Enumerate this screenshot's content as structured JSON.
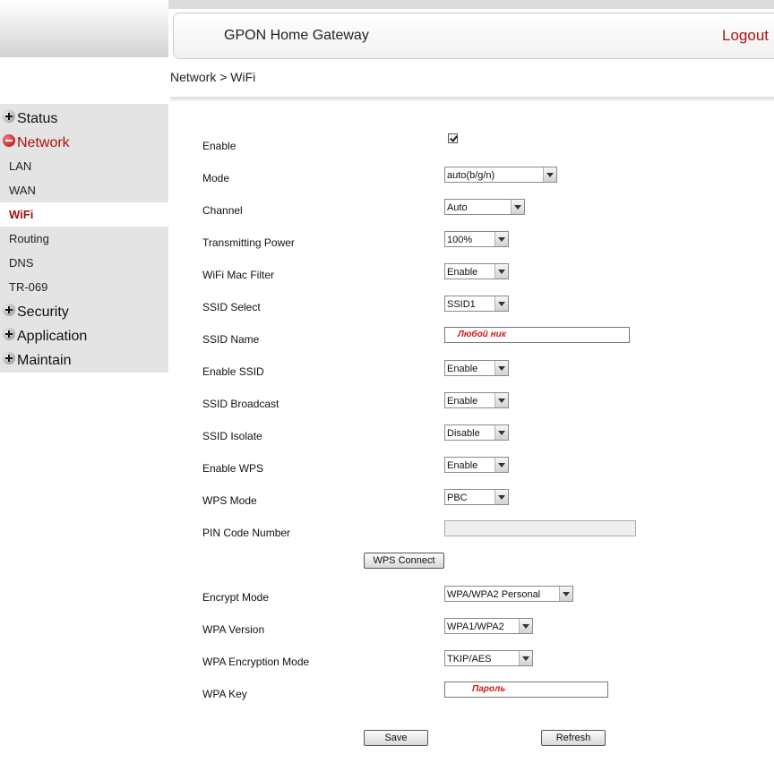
{
  "header": {
    "title": "GPON Home Gateway",
    "logout": "Logout"
  },
  "breadcrumb": "Network > WiFi",
  "sidebar": {
    "status": "Status",
    "network": "Network",
    "sub": [
      "LAN",
      "WAN",
      "WiFi",
      "Routing",
      "DNS",
      "TR-069"
    ],
    "security": "Security",
    "application": "Application",
    "maintain": "Maintain"
  },
  "form": {
    "enable": {
      "label": "Enable",
      "checked": true
    },
    "mode": {
      "label": "Mode",
      "value": "auto(b/g/n)"
    },
    "channel": {
      "label": "Channel",
      "value": "Auto"
    },
    "tx_power": {
      "label": "Transmitting Power",
      "value": "100%"
    },
    "mac_filter": {
      "label": "WiFi Mac Filter",
      "value": "Enable"
    },
    "ssid_select": {
      "label": "SSID Select",
      "value": "SSID1"
    },
    "ssid_name": {
      "label": "SSID Name",
      "value": "Любой ник"
    },
    "enable_ssid": {
      "label": "Enable SSID",
      "value": "Enable"
    },
    "ssid_broadcast": {
      "label": "SSID Broadcast",
      "value": "Enable"
    },
    "ssid_isolate": {
      "label": "SSID Isolate",
      "value": "Disable"
    },
    "enable_wps": {
      "label": "Enable WPS",
      "value": "Enable"
    },
    "wps_mode": {
      "label": "WPS Mode",
      "value": "PBC"
    },
    "pin_code": {
      "label": "PIN Code Number",
      "value": ""
    },
    "wps_connect": "WPS  Connect",
    "encrypt_mode": {
      "label": "Encrypt Mode",
      "value": "WPA/WPA2 Personal"
    },
    "wpa_version": {
      "label": "WPA Version",
      "value": "WPA1/WPA2"
    },
    "wpa_enc_mode": {
      "label": "WPA Encryption Mode",
      "value": "TKIP/AES"
    },
    "wpa_key": {
      "label": "WPA Key",
      "value": "Пароль"
    },
    "save": "Save",
    "refresh": "Refresh"
  },
  "colors": {
    "accent": "#b01010",
    "sidebar_bg": "#e4e4e4"
  }
}
